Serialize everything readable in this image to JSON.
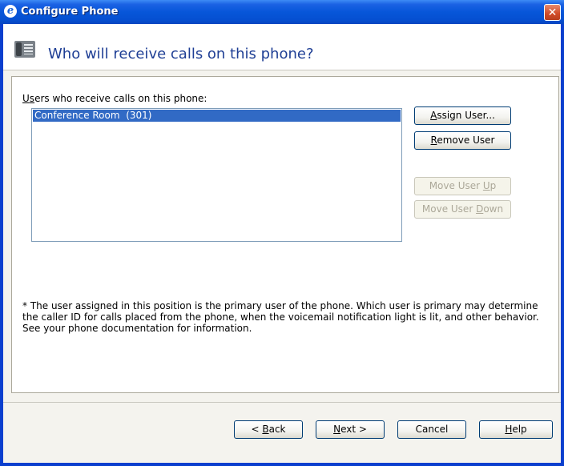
{
  "window": {
    "title": "Configure Phone",
    "close_label": "✕"
  },
  "header": {
    "title": "Who will receive calls on this phone?"
  },
  "users": {
    "label_pre": "U",
    "label_mn": "s",
    "label_post": "ers who receive calls on this phone:",
    "items": [
      {
        "label": "Conference Room  (301)",
        "selected": true
      }
    ]
  },
  "side_buttons": {
    "assign": {
      "mn": "A",
      "rest": "ssign User..."
    },
    "remove": {
      "mn": "R",
      "rest": "emove User"
    },
    "move_up": {
      "pre": "Move User ",
      "mn": "U",
      "post": "p"
    },
    "move_down": {
      "pre": "Move User ",
      "mn": "D",
      "post": "own"
    }
  },
  "note": "* The user assigned in this position is the primary user of the phone. Which user is primary may determine the caller ID for calls placed from the phone, when the voicemail notification light is lit, and other behavior. See your phone documentation for information.",
  "footer": {
    "back": {
      "pre": "< ",
      "mn": "B",
      "post": "ack"
    },
    "next": {
      "mn": "N",
      "post": "ext >"
    },
    "cancel": "Cancel",
    "help": {
      "mn": "H",
      "post": "elp"
    }
  },
  "colors": {
    "title_bar": "#0756d9",
    "selection": "#316ac5",
    "header_text": "#1f3f95"
  }
}
